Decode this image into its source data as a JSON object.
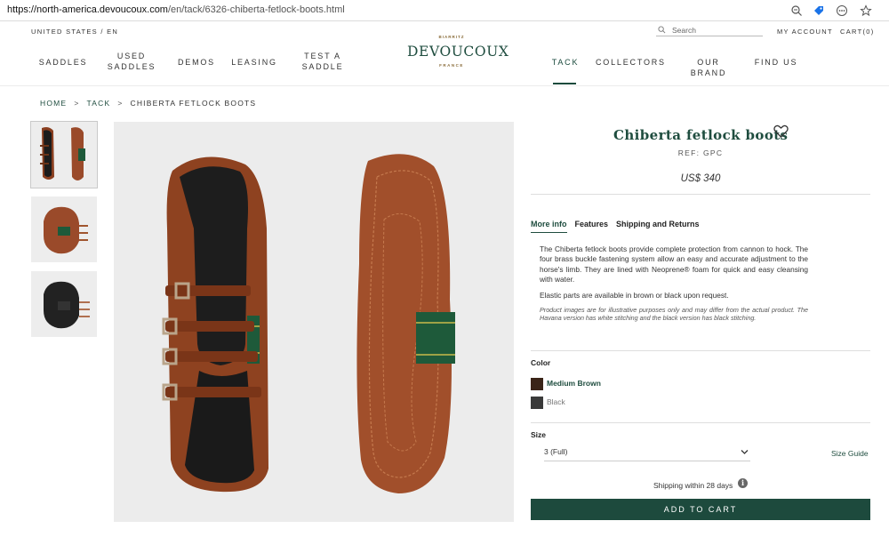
{
  "browser": {
    "url_host": "https://north-america.devoucoux.com",
    "url_path": "/en/tack/6326-chiberta-fetlock-boots.html"
  },
  "header": {
    "locale": "UNITED STATES / EN",
    "search_placeholder": "Search",
    "my_account": "MY ACCOUNT",
    "cart": "CART(0)",
    "logo": {
      "top": "BIARRITZ",
      "name": "DEVOUCOUX",
      "bottom": "FRANCE"
    },
    "nav_left": [
      {
        "line1": "SADDLES",
        "line2": ""
      },
      {
        "line1": "USED",
        "line2": "SADDLES"
      },
      {
        "line1": "DEMOS",
        "line2": ""
      },
      {
        "line1": "LEASING",
        "line2": ""
      },
      {
        "line1": "TEST A",
        "line2": "SADDLE"
      }
    ],
    "nav_right": [
      {
        "label": "TACK",
        "active": true
      },
      {
        "label": "COLLECTORS",
        "active": false
      },
      {
        "label": "OUR BRAND",
        "active": false
      },
      {
        "label": "FIND US",
        "active": false
      }
    ]
  },
  "breadcrumb": {
    "home": "HOME",
    "tack": "TACK",
    "current": "CHIBERTA FETLOCK BOOTS",
    "separator": ">"
  },
  "product": {
    "title": "Chiberta fetlock boots",
    "ref": "REF: GPC",
    "price": "US$ 340",
    "tabs": [
      "More info",
      "Features",
      "Shipping and Returns"
    ],
    "description": "The Chiberta fetlock boots provide complete protection from cannon to hock. The four brass buckle fastening system allow an easy and accurate adjustment to the horse's limb. They are lined with Neoprene® foam for quick and easy cleansing with water.",
    "elastic_note": "Elastic parts are available in brown or black upon request.",
    "disclaimer": "Product images are for illustrative purposes only and may differ from the actual product. The Havana version has white stitching and the black version has black stitching.",
    "color_label": "Color",
    "colors": [
      {
        "name": "Medium Brown",
        "hex": "#3a2418",
        "selected": true
      },
      {
        "name": "Black",
        "hex": "#3a3a3a",
        "selected": false
      }
    ],
    "size_label": "Size",
    "size_value": "3 (Full)",
    "size_guide": "Size Guide",
    "shipping": "Shipping within 28 days",
    "add_to_cart": "ADD TO CART"
  },
  "colors": {
    "brand_green": "#1d4a3d",
    "leather": "#9a4a2a",
    "elastic_green": "#1e5a3a"
  }
}
